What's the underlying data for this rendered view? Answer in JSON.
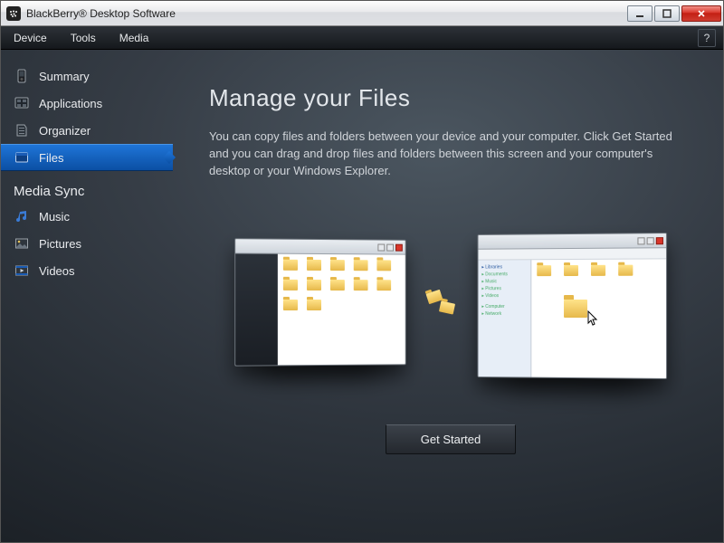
{
  "window": {
    "title": "BlackBerry® Desktop Software"
  },
  "menu": {
    "device": "Device",
    "tools": "Tools",
    "media": "Media",
    "help": "?"
  },
  "sidebar": {
    "items": [
      {
        "label": "Summary"
      },
      {
        "label": "Applications"
      },
      {
        "label": "Organizer"
      },
      {
        "label": "Files"
      }
    ],
    "media_header": "Media Sync",
    "media_items": [
      {
        "label": "Music"
      },
      {
        "label": "Pictures"
      },
      {
        "label": "Videos"
      }
    ]
  },
  "main": {
    "title": "Manage your Files",
    "description": "You can copy files and folders between your device and your computer.  Click Get Started and you can drag and drop files and folders between this screen and your computer's desktop or your Windows Explorer.",
    "cta": "Get Started"
  }
}
